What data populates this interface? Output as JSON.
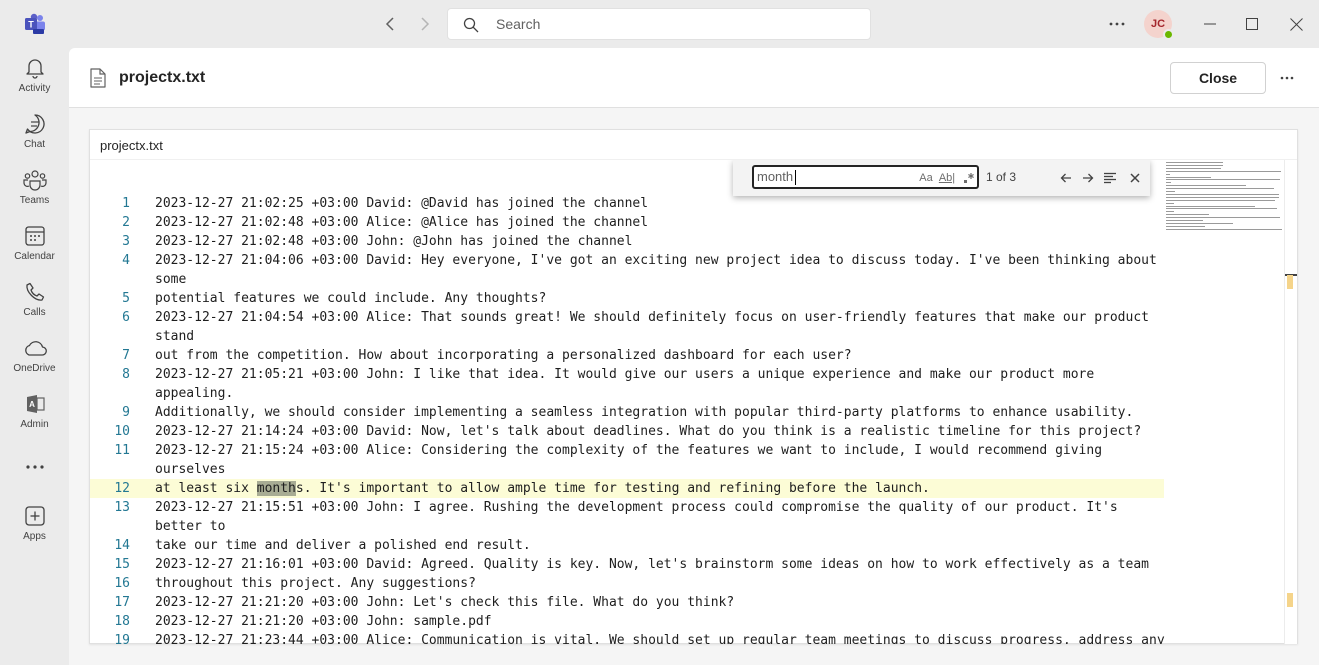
{
  "titlebar": {
    "search_placeholder": "Search",
    "avatar_initials": "JC",
    "icons": [
      "teams-logo-icon",
      "back-arrow-icon",
      "forward-arrow-icon",
      "search-icon",
      "more-icon",
      "minimize-icon",
      "maximize-icon",
      "close-window-icon"
    ]
  },
  "rail": {
    "items": [
      {
        "label": "Activity",
        "icon": "bell-icon"
      },
      {
        "label": "Chat",
        "icon": "chat-icon"
      },
      {
        "label": "Teams",
        "icon": "teams-icon"
      },
      {
        "label": "Calendar",
        "icon": "calendar-icon"
      },
      {
        "label": "Calls",
        "icon": "phone-icon"
      },
      {
        "label": "OneDrive",
        "icon": "cloud-icon"
      },
      {
        "label": "Admin",
        "icon": "admin-icon"
      },
      {
        "label": "",
        "icon": "more-apps-icon"
      },
      {
        "label": "Apps",
        "icon": "add-apps-icon"
      }
    ]
  },
  "file": {
    "title": "projectx.txt",
    "close_label": "Close",
    "viewer_title": "projectx.txt"
  },
  "find": {
    "query": "month",
    "match_case_label": "Aa",
    "whole_word_label": "Ab|",
    "count": "1 of 3"
  },
  "editor": {
    "current_line": 12,
    "lines": [
      {
        "n": "1",
        "text": "2023-12-27 21:02:25 +03:00 David: @David has joined the channel"
      },
      {
        "n": "2",
        "text": "2023-12-27 21:02:48 +03:00 Alice: @Alice has joined the channel"
      },
      {
        "n": "3",
        "text": "2023-12-27 21:02:48 +03:00 John: @John has joined the channel"
      },
      {
        "n": "4",
        "text": "2023-12-27 21:04:06 +03:00 David: Hey everyone, I've got an exciting new project idea to discuss today. I've been thinking about"
      },
      {
        "n": "",
        "text": "some"
      },
      {
        "n": "5",
        "text": "potential features we could include. Any thoughts?"
      },
      {
        "n": "6",
        "text": "2023-12-27 21:04:54 +03:00 Alice: That sounds great! We should definitely focus on user-friendly features that make our product"
      },
      {
        "n": "",
        "text": "stand"
      },
      {
        "n": "7",
        "text": "out from the competition. How about incorporating a personalized dashboard for each user?"
      },
      {
        "n": "8",
        "text": "2023-12-27 21:05:21 +03:00 John: I like that idea. It would give our users a unique experience and make our product more"
      },
      {
        "n": "",
        "text": "appealing."
      },
      {
        "n": "9",
        "text": "Additionally, we should consider implementing a seamless integration with popular third-party platforms to enhance usability."
      },
      {
        "n": "10",
        "text": "2023-12-27 21:14:24 +03:00 David: Now, let's talk about deadlines. What do you think is a realistic timeline for this project?"
      },
      {
        "n": "11",
        "text": "2023-12-27 21:15:24 +03:00 Alice: Considering the complexity of the features we want to include, I would recommend giving"
      },
      {
        "n": "",
        "text": "ourselves"
      },
      {
        "n": "12",
        "text_before": "at least six ",
        "text_match": "month",
        "text_after": "s. It's important to allow ample time for testing and refining before the launch."
      },
      {
        "n": "13",
        "text": "2023-12-27 21:15:51 +03:00 John: I agree. Rushing the development process could compromise the quality of our product. It's"
      },
      {
        "n": "",
        "text": "better to"
      },
      {
        "n": "14",
        "text": "take our time and deliver a polished end result."
      },
      {
        "n": "15",
        "text": "2023-12-27 21:16:01 +03:00 David: Agreed. Quality is key. Now, let's brainstorm some ideas on how to work effectively as a team"
      },
      {
        "n": "16",
        "text": "throughout this project. Any suggestions?"
      },
      {
        "n": "17",
        "text": "2023-12-27 21:21:20 +03:00 John: Let's check this file. What do you think?"
      },
      {
        "n": "18",
        "text": "2023-12-27 21:21:20 +03:00 John: sample.pdf"
      },
      {
        "n": "19",
        "text": "2023-12-27 21:23:44 +03:00 Alice: Communication is vital. We should set up regular team meetings to discuss progress, address any"
      }
    ]
  },
  "colors": {
    "accent": "#5b5fc7",
    "line_number": "#237893",
    "current_line_bg": "#fcfcd6",
    "match_bg": "#a8ac94",
    "presence": "#6bb700"
  }
}
